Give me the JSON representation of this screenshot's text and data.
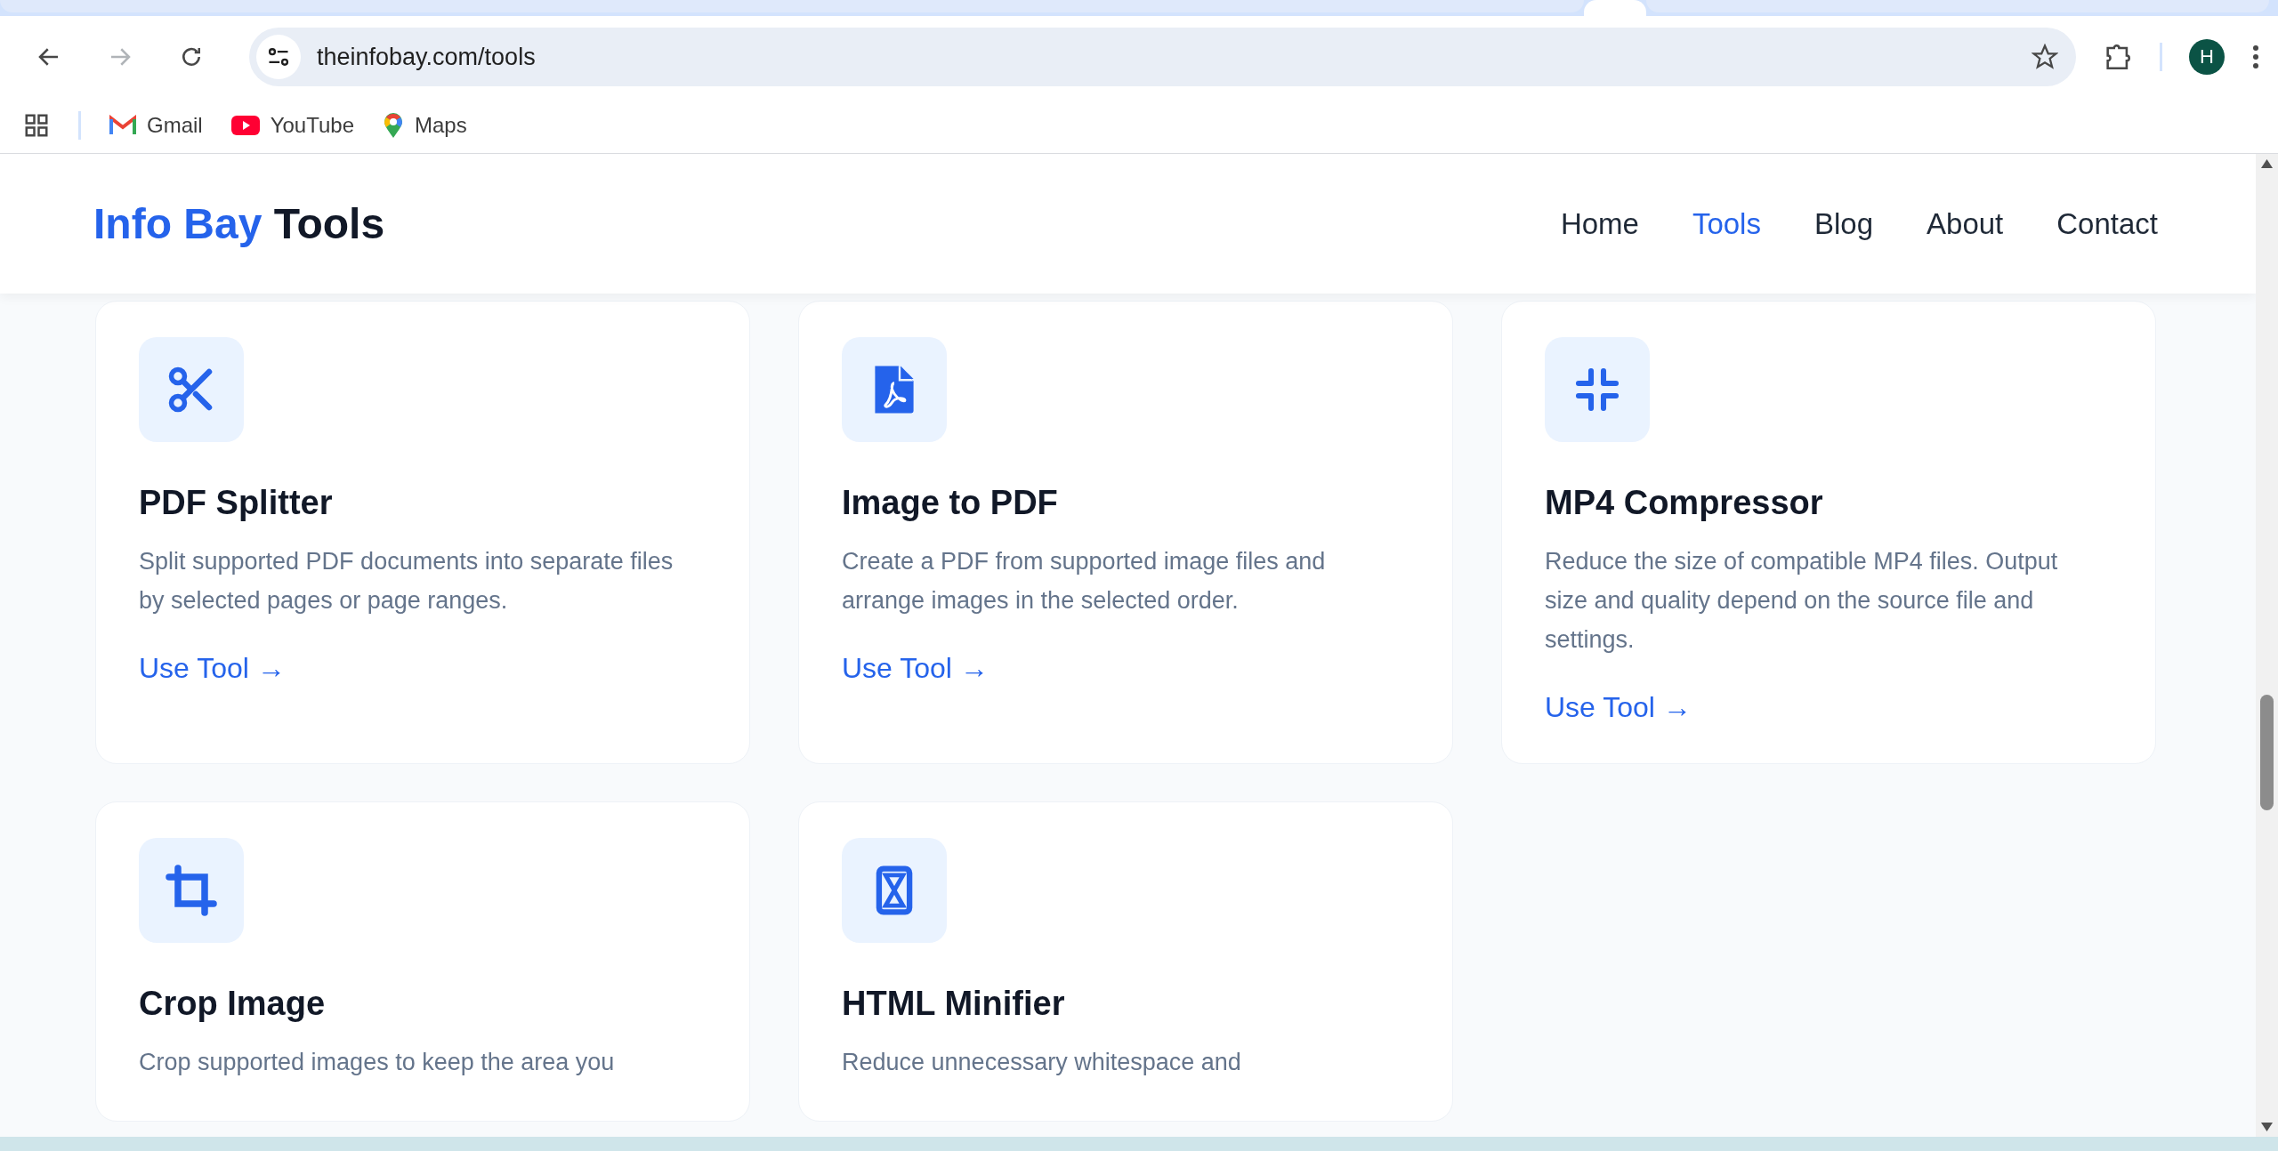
{
  "browser": {
    "nav_buttons": [
      {
        "kind": "back",
        "disabled": false
      },
      {
        "kind": "forward",
        "disabled": true
      },
      {
        "kind": "reload",
        "disabled": false
      }
    ],
    "address": "theinfobay.com/tools",
    "avatar": "H",
    "bookmarks": [
      {
        "kind": "gmail",
        "label": "Gmail"
      },
      {
        "kind": "youtube",
        "label": "YouTube"
      },
      {
        "kind": "maps",
        "label": "Maps"
      }
    ]
  },
  "site": {
    "logo": {
      "accent": "Info Bay",
      "rest": "Tools"
    },
    "nav": [
      {
        "label": "Home",
        "selected": false
      },
      {
        "label": "Tools",
        "selected": true
      },
      {
        "label": "Blog",
        "selected": false
      },
      {
        "label": "About",
        "selected": false
      },
      {
        "label": "Contact",
        "selected": false
      }
    ]
  },
  "tools": [
    {
      "kind": "scissors",
      "title": "PDF Splitter",
      "description": "Split supported PDF documents into separate files by selected pages or page ranges.",
      "link": "Use Tool →"
    },
    {
      "kind": "pdf",
      "title": "Image to PDF",
      "description": "Create a PDF from supported image files and arrange images in the selected order.",
      "link": "Use Tool →"
    },
    {
      "kind": "compress",
      "title": "MP4 Compressor",
      "description": "Reduce the size of compatible MP4 files. Output size and quality depend on the source file and settings.",
      "link": "Use Tool →"
    },
    {
      "kind": "crop",
      "title": "Crop Image",
      "description": "Crop supported images to keep the area you"
    },
    {
      "kind": "hourglass",
      "title": "HTML Minifier",
      "description": "Reduce unnecessary whitespace and"
    }
  ]
}
